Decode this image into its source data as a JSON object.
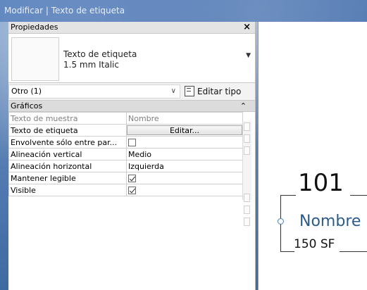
{
  "window": {
    "title": "Modificar | Texto de etiqueta"
  },
  "properties_panel": {
    "title": "Propiedades",
    "close_glyph": "×",
    "type_selector": {
      "type_name_line1": "Texto de etiqueta",
      "type_name_line2": "1.5 mm Italic",
      "dropdown_glyph": "▼"
    },
    "instance_filter": {
      "value": "Otro (1)",
      "caret": "∨"
    },
    "edit_type_label": "Editar tipo",
    "group": {
      "name": "Gráficos",
      "collapse_glyph": "⌃"
    },
    "rows": [
      {
        "name": "Texto de muestra",
        "value": "Nombre",
        "name_disabled": true
      },
      {
        "name": "Texto de etiqueta",
        "button": "Editar..."
      },
      {
        "name": "Envolvente sólo entre par...",
        "checked": false
      },
      {
        "name": "Alineación vertical",
        "value": "Medio"
      },
      {
        "name": "Alineación horizontal",
        "value": "Izquierda"
      },
      {
        "name": "Mantener legible",
        "checked": true
      },
      {
        "name": "Visible",
        "checked": true
      }
    ]
  },
  "canvas": {
    "room_number": "101",
    "room_name": "Nombre",
    "room_area": "150 SF"
  }
}
